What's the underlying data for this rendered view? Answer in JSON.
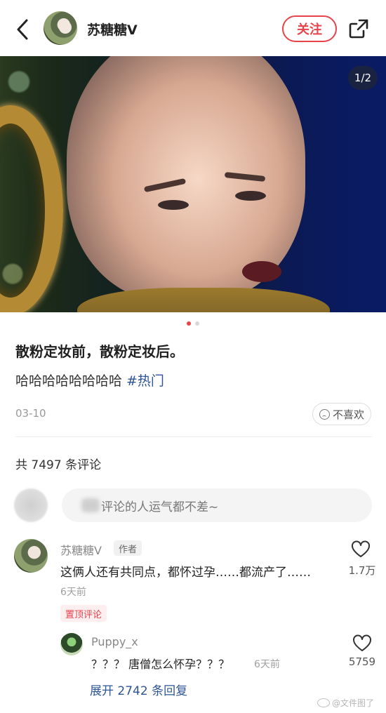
{
  "header": {
    "user_name": "苏糖糖Ⅴ",
    "follow_label": "关注"
  },
  "carousel": {
    "counter": "1/2",
    "total": 2,
    "active_index": 1
  },
  "post": {
    "title": "散粉定妆前，散粉定妆后。",
    "body": "哈哈哈哈哈哈哈哈",
    "hashtag": "#热门",
    "date": "03-10",
    "dislike_label": "不喜欢"
  },
  "comments_section": {
    "count_label": "共 7497 条评论",
    "input_placeholder": "评论的人运气都不差~"
  },
  "comment": {
    "user_name": "苏糖糖Ⅴ",
    "author_tag": "作者",
    "text": "这俩人还有共同点，都怀过孕……都流产了……",
    "time": "6天前",
    "pin_tag": "置顶评论",
    "like_count": "1.7万"
  },
  "reply": {
    "user_name": "Puppy_x",
    "text": "？？？ 唐僧怎么怀孕？？？",
    "time": "6天前",
    "like_count": "5759",
    "expand_label": "展开 2742 条回复"
  },
  "watermark": "@文件图了",
  "colors": {
    "accent": "#e8434b",
    "link": "#2e5596"
  }
}
